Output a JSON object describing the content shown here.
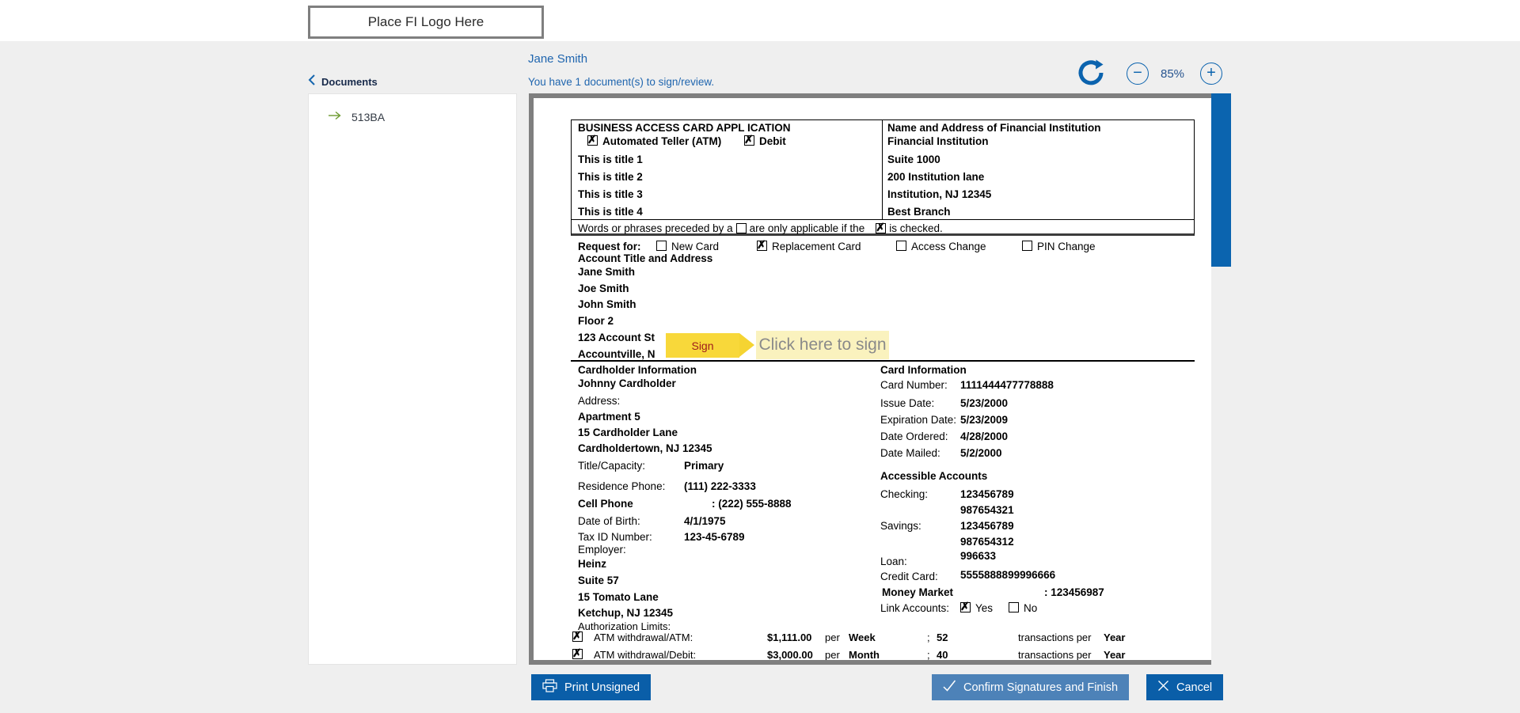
{
  "header": {
    "logo_text": "Place FI Logo Here"
  },
  "sidebar": {
    "back_label": "Documents",
    "documents": [
      {
        "label": "513BA"
      }
    ]
  },
  "session": {
    "user_name": "Jane Smith",
    "status": "You have 1 document(s) to sign/review.",
    "zoom_level": "85%"
  },
  "sign": {
    "tab": "Sign",
    "prompt": "Click here to sign"
  },
  "form": {
    "title": "BUSINESS ACCESS CARD APPL ICATION",
    "card_types": [
      {
        "label": "Automated Teller (ATM)",
        "checked": true
      },
      {
        "label": "Debit",
        "checked": true
      }
    ],
    "title_lines": [
      "This is title 1",
      "This is title 2",
      "This is title 3",
      "This is title 4"
    ],
    "fi_header": "Name and Address of Financial Institution",
    "fi_lines": [
      "Financial Institution",
      "Suite 1000",
      "200 Institution lane",
      "Institution, NJ 12345",
      "Best Branch"
    ],
    "note": {
      "part1": "Words or phrases preceded by a",
      "part2": "are only applicable if the",
      "part3": "is checked."
    },
    "request_label": "Request for:",
    "request_options": [
      {
        "label": "New Card",
        "checked": false
      },
      {
        "label": "Replacement Card",
        "checked": true
      },
      {
        "label": "Access Change",
        "checked": false
      },
      {
        "label": "PIN Change",
        "checked": false
      }
    ],
    "account_header": "Account Title and Address",
    "account_lines": [
      "Jane Smith",
      "Joe Smith",
      "John Smith",
      "Floor 2",
      "123 Account St",
      "Accountville, N"
    ],
    "cardholder_header": "Cardholder Information",
    "cardholder_name": "Johnny Cardholder",
    "address_label": "Address:",
    "address_lines": [
      "Apartment 5",
      "15 Cardholder Lane",
      "Cardholdertown, NJ 12345"
    ],
    "title_capacity_label": "Title/Capacity:",
    "title_capacity": "Primary",
    "residence_phone_label": "Residence Phone:",
    "residence_phone": "(111) 222-3333",
    "cell_phone_label": "Cell Phone",
    "cell_phone": ": (222) 555-8888",
    "dob_label": "Date of Birth:",
    "dob": "4/1/1975",
    "tax_id_label": "Tax ID Number:",
    "tax_id": "123-45-6789",
    "employer_label": "Employer:",
    "employer_lines": [
      "Heinz",
      "Suite 57",
      "15 Tomato Lane",
      "Ketchup, NJ 12345"
    ],
    "card_info_header": "Card Information",
    "card_fields": [
      {
        "label": "Card Number:",
        "value": "1111444477778888"
      },
      {
        "label": "Issue Date:",
        "value": "5/23/2000"
      },
      {
        "label": "Expiration Date:",
        "value": "5/23/2009"
      },
      {
        "label": "Date Ordered:",
        "value": "4/28/2000"
      },
      {
        "label": "Date Mailed:",
        "value": "5/2/2000"
      }
    ],
    "accounts_header": "Accessible Accounts",
    "checking_label": "Checking:",
    "checking": [
      "123456789",
      "987654321"
    ],
    "savings_label": "Savings:",
    "savings": [
      "123456789",
      "987654312"
    ],
    "loan_label": "Loan:",
    "loan": "996633",
    "credit_label": "Credit Card:",
    "credit": "5555888899996666",
    "mm_label": "Money Market",
    "mm_value": ": 123456987",
    "link_label": "Link Accounts:",
    "link_yes": "Yes",
    "link_no": "No",
    "link_yes_checked": true,
    "link_no_checked": false,
    "auth_header": "Authorization Limits:",
    "auth_rows": [
      {
        "checked": true,
        "label": "ATM withdrawal/ATM:",
        "amount": "$1,111.00",
        "per": "per",
        "period": "Week",
        "semi": ";",
        "count": "52",
        "tx": "transactions per",
        "unit": "Year"
      },
      {
        "checked": true,
        "label": "ATM withdrawal/Debit:",
        "amount": "$3,000.00",
        "per": "per",
        "period": "Month",
        "semi": ";",
        "count": "40",
        "tx": "transactions per",
        "unit": "Year"
      }
    ]
  },
  "footer": {
    "print": "Print Unsigned",
    "confirm": "Confirm Signatures and Finish",
    "cancel": "Cancel"
  },
  "colors": {
    "accent_blue": "#0a5ea8",
    "confirm_blue": "#4d82b8",
    "link_blue": "#2066af",
    "scrollbar_blue": "#0b64af",
    "sign_yellow": "#f8d83a",
    "sign_light_yellow": "#faf2be",
    "sign_text_red": "#9e1b1b",
    "doc_item_arrow_green": "#6c9a2f"
  }
}
